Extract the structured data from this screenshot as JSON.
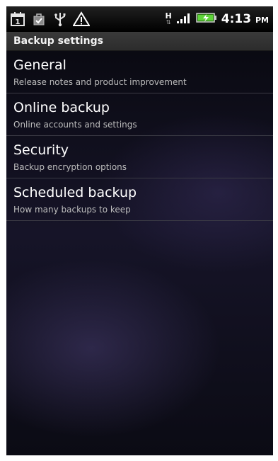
{
  "status_bar": {
    "icons": [
      "calendar-icon",
      "checkbox-bag-icon",
      "usb-icon",
      "warning-icon",
      "h-network-icon",
      "signal-icon",
      "battery-charging-icon"
    ],
    "calendar_day": "1",
    "network_type": "H",
    "time": "4:13",
    "ampm": "PM",
    "colors": {
      "battery": "#5fd43a",
      "warning": "#ffffff"
    }
  },
  "title_bar": {
    "title": "Backup settings"
  },
  "settings": {
    "items": [
      {
        "title": "General",
        "subtitle": "Release notes and product improvement"
      },
      {
        "title": "Online backup",
        "subtitle": "Online accounts and settings"
      },
      {
        "title": "Security",
        "subtitle": "Backup encryption options"
      },
      {
        "title": "Scheduled backup",
        "subtitle": "How many backups to keep"
      }
    ]
  }
}
